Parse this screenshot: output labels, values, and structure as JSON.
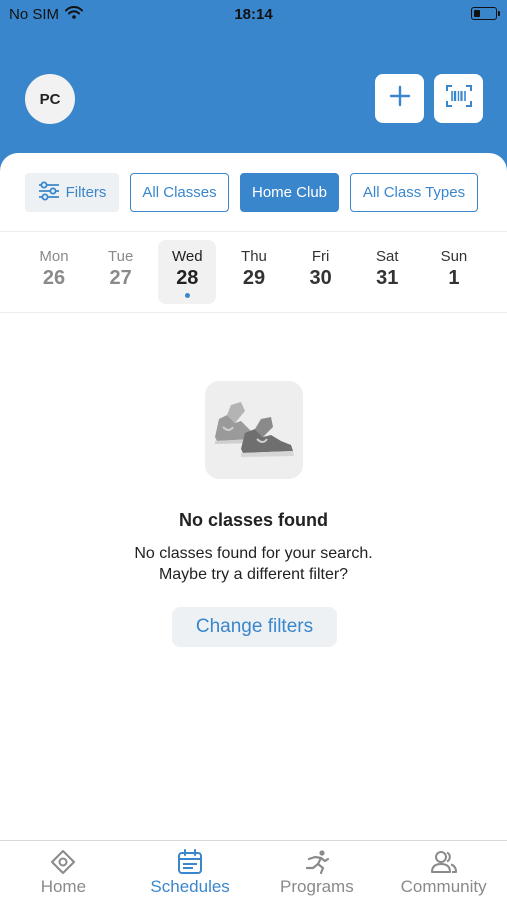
{
  "status_bar": {
    "carrier": "No SIM",
    "time": "18:14",
    "battery_level": 0.3
  },
  "header": {
    "avatar_initials": "PC",
    "add_icon": "plus-icon",
    "scan_icon": "barcode-scan-icon",
    "background_color": "#3a86cc"
  },
  "filters": {
    "filters_label": "Filters",
    "filters_icon": "sliders-icon",
    "chips": [
      {
        "label": "All Classes",
        "selected": false
      },
      {
        "label": "Home Club",
        "selected": true
      },
      {
        "label": "All Class Types",
        "selected": false
      }
    ]
  },
  "week": {
    "days": [
      {
        "name": "Mon",
        "date": "26",
        "state": "past"
      },
      {
        "name": "Tue",
        "date": "27",
        "state": "past"
      },
      {
        "name": "Wed",
        "date": "28",
        "state": "selected"
      },
      {
        "name": "Thu",
        "date": "29",
        "state": "future"
      },
      {
        "name": "Fri",
        "date": "30",
        "state": "future"
      },
      {
        "name": "Sat",
        "date": "31",
        "state": "future"
      },
      {
        "name": "Sun",
        "date": "1",
        "state": "future"
      }
    ]
  },
  "empty_state": {
    "icon": "sneakers-icon",
    "title": "No classes found",
    "message_line1": "No classes found for your search.",
    "message_line2": "Maybe try a different filter?",
    "button_label": "Change filters"
  },
  "tab_bar": {
    "tabs": [
      {
        "label": "Home",
        "icon": "home-icon",
        "active": false
      },
      {
        "label": "Schedules",
        "icon": "calendar-icon",
        "active": true
      },
      {
        "label": "Programs",
        "icon": "running-person-icon",
        "active": false
      },
      {
        "label": "Community",
        "icon": "people-icon",
        "active": false
      }
    ]
  },
  "colors": {
    "accent": "#3a86cc",
    "inactive_text": "#8a8a8a"
  }
}
